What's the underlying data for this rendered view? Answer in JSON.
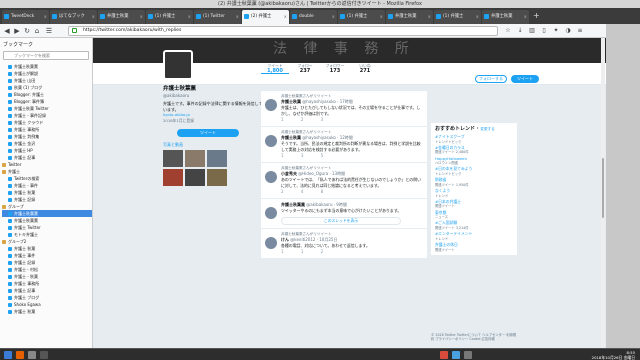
{
  "window": {
    "title": "(2) 弁護士秋葉薫 (@akibakaoru)さん | Twitterからの返信付きツイート - Mozilla Firefox"
  },
  "tabs": [
    {
      "label": "TweetDeck"
    },
    {
      "label": "はてなブック"
    },
    {
      "label": "弁護士秋葉"
    },
    {
      "label": "(1) 弁護士"
    },
    {
      "label": "(1) Twitter"
    },
    {
      "label": "(2) 弁護士"
    },
    {
      "label": "double"
    },
    {
      "label": "(1) 弁護士"
    },
    {
      "label": "弁護士秋葉"
    },
    {
      "label": "(1) 弁護士"
    },
    {
      "label": "弁護士秋葉"
    }
  ],
  "navbar": {
    "url": "https://twitter.com/akibakaoru/with_replies"
  },
  "bookmarks": {
    "header": "ブックマーク",
    "search_placeholder": "ブックマークを検索",
    "items": [
      {
        "label": "弁護士秋葉薫",
        "folder": false,
        "selected": false
      },
      {
        "label": "弁護士が解説",
        "folder": false,
        "selected": false
      },
      {
        "label": "弁護士 山田",
        "folder": false,
        "selected": false
      },
      {
        "label": "秋葉 (1) ブログ",
        "folder": false,
        "selected": false
      },
      {
        "label": "Blogger: 弁護士",
        "folder": false,
        "selected": false
      },
      {
        "label": "Blogger: 事件簿",
        "folder": false,
        "selected": false
      },
      {
        "label": "弁護士秋葉 Twitter",
        "folder": false,
        "selected": false
      },
      {
        "label": "弁護士 - 事件記録",
        "folder": false,
        "selected": false
      },
      {
        "label": "弁護士 クラウド",
        "folder": false,
        "selected": false
      },
      {
        "label": "弁護士 事務所",
        "folder": false,
        "selected": false
      },
      {
        "label": "弁護士 判例集",
        "folder": false,
        "selected": false
      },
      {
        "label": "弁護士 金沢",
        "folder": false,
        "selected": false
      },
      {
        "label": "弁護士 HP",
        "folder": false,
        "selected": false
      },
      {
        "label": "弁護士 記事",
        "folder": false,
        "selected": false
      },
      {
        "label": "Twitter",
        "folder": true,
        "selected": false
      },
      {
        "label": "弁護士",
        "folder": true,
        "selected": false
      },
      {
        "label": "Twitterの検索",
        "folder": false,
        "selected": false
      },
      {
        "label": "弁護士 - 事件",
        "folder": false,
        "selected": false
      },
      {
        "label": "弁護士 秋葉",
        "folder": false,
        "selected": false
      },
      {
        "label": "弁護士 記録",
        "folder": false,
        "selected": false
      },
      {
        "label": "グループ",
        "folder": true,
        "selected": false
      },
      {
        "label": "弁護士秋葉薫",
        "folder": false,
        "selected": true
      },
      {
        "label": "弁護士秋葉薫",
        "folder": false,
        "selected": false
      },
      {
        "label": "弁護士 Twitter",
        "folder": false,
        "selected": false
      },
      {
        "label": "モトキ弁護士",
        "folder": false,
        "selected": false
      },
      {
        "label": "グループ2",
        "folder": true,
        "selected": false
      },
      {
        "label": "弁護士 秋葉",
        "folder": false,
        "selected": false
      },
      {
        "label": "弁護士 事件",
        "folder": false,
        "selected": false
      },
      {
        "label": "弁護士 記録",
        "folder": false,
        "selected": false
      },
      {
        "label": "弁護士 - 村松",
        "folder": false,
        "selected": false
      },
      {
        "label": "弁護士 - 秋葉",
        "folder": false,
        "selected": false
      },
      {
        "label": "弁護士 事務所",
        "folder": false,
        "selected": false
      },
      {
        "label": "弁護士 記事",
        "folder": false,
        "selected": false
      },
      {
        "label": "弁護士 ブログ",
        "folder": false,
        "selected": false
      },
      {
        "label": "Shoko Egawa",
        "folder": false,
        "selected": false
      },
      {
        "label": "弁護士 秋葉",
        "folder": false,
        "selected": false
      }
    ]
  },
  "profile": {
    "cover_text": "法 律 事 務 所",
    "stats": [
      {
        "label": "ツイート",
        "value": "1,800"
      },
      {
        "label": "フォロー",
        "value": "237"
      },
      {
        "label": "フォロワー",
        "value": "173"
      },
      {
        "label": "いいね",
        "value": "271"
      }
    ],
    "follow_label": "フォローする",
    "tweet_label": "ツイート",
    "name": "弁護士秋葉薫",
    "handle": "@akibakaoru",
    "bio": "弁護士です。事件の記録や法律に関する情報を発信しています。",
    "location": "kyoto-akiba.jp",
    "joined": "2018年1月に登録",
    "tweet_button": "ツイート",
    "photos_label": "写真と動画"
  },
  "timeline": [
    {
      "context": "弁護士秋葉薫さんがリツイート",
      "name": "弁護士秋葉",
      "handle": "@hayashiyasuko · 17時間",
      "text": "弁護士は、ひとたびしてもしない状況では、その立場を守ることが仕事です。しかし、なぜか評価は別です。",
      "actions": "1 2 3"
    },
    {
      "context": "弁護士秋葉薫さんがリツイート",
      "name": "弁護士秋葉",
      "handle": "@hayashiyasuko · 12時間",
      "text": "そうです。当所、民法の規定と裁判所の判断が異なる場合は、判例と学説を比較して実務上の対応を検討する必要があります。",
      "actions": "1 3 5"
    },
    {
      "context": "弁護士秋葉薫さんがリツイート",
      "name": "小倉秀夫",
      "handle": "@Hideo_Ogura · 13時間",
      "text": "あのツイートでは、「私人であれば法的責任が生じないのでしょうか」との問いに対して、法的に見れば同じ結論になると考えています。",
      "actions": "2 4 8"
    },
    {
      "context": "",
      "name": "弁護士秋葉薫",
      "handle": "@akibakaoru · 9時間",
      "text": "ツイッターやるのにもまず本当の意味で心がけたいことがあります。",
      "actions": "",
      "reply": "このスレッドを表示"
    },
    {
      "context": "弁護士秋葉薫さんがリツイート",
      "name": "けん",
      "handle": "@keniti2012 · 10月25日",
      "text": "各種の電話、対応について。あわせて返信します。",
      "actions": "1 1 2"
    }
  ],
  "trends": {
    "title": "おすすめトレンド",
    "change": "変更する",
    "items": [
      {
        "name": "#ナイトスクープ",
        "desc": "トレンドトピック"
      },
      {
        "name": "#金曜日のカラス",
        "desc": "関連ツイート 2,480件"
      },
      {
        "name": "HappyHalloween",
        "desc": "ハロウィン関連"
      },
      {
        "name": "#日の本を見てみよう",
        "desc": "トレンドトピック"
      },
      {
        "name": "財務省",
        "desc": "関連ツイート 1,950件"
      },
      {
        "name": "なくよう",
        "desc": "トレンド"
      },
      {
        "name": "#日本の弁護士",
        "desc": "関連ツイート"
      },
      {
        "name": "東京都",
        "desc": "ニュース"
      },
      {
        "name": "#ご入国試験",
        "desc": "関連ツイート 3,214件"
      },
      {
        "name": "#エンターテイメント",
        "desc": "トレンド"
      },
      {
        "name": "弁護士の休日",
        "desc": "関連ツイート"
      }
    ],
    "footer": "© 2018 Twitter  Twitterについて  ヘルプセンター  利用規約  プライバシーポリシー  Cookie  広告情報"
  },
  "taskbar": {
    "time": "8:55",
    "date": "2018年10月26日 金曜日"
  },
  "colors": {
    "twitter_blue": "#1da1f2",
    "selection": "#3d8ae0"
  }
}
